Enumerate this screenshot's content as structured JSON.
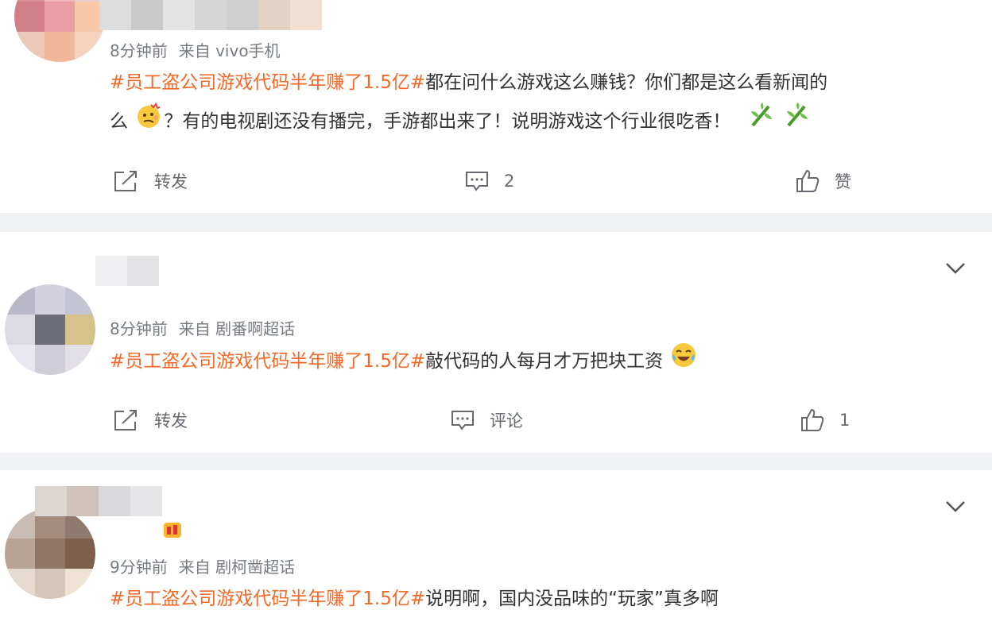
{
  "comments": [
    {
      "time": "8分钟前",
      "source": "来自 vivo手机",
      "topic": "#员工盗公司游戏代码半年赚了1.5亿#",
      "text_part1": "都在问什么游戏这么赚钱？你们都是这么看新闻的",
      "text_part2_prefix": "么",
      "text_part2": "？有的电视剧还没有播完，手游都出来了！说明游戏这个行业很吃香！",
      "repost_label": "转发",
      "comment_count": "2",
      "like_label": "赞",
      "emoji_1": "confused-face-emoji",
      "emoji_2": "bamboo-emoji"
    },
    {
      "time": "8分钟前",
      "source": "来自 剧番啊超话",
      "topic": "#员工盗公司游戏代码半年赚了1.5亿#",
      "text": "敲代码的人每月才万把块工资",
      "repost_label": "转发",
      "comment_label": "评论",
      "like_count": "1",
      "emoji": "laugh-cry-emoji"
    },
    {
      "time": "9分钟前",
      "source": "来自 剧柯凿超话",
      "topic": "#员工盗公司游戏代码半年赚了1.5亿#",
      "text": "说明啊，国内没品味的“玩家”真多啊",
      "badge": "fan-badge-icon"
    }
  ],
  "colors": {
    "topic": "#f26a2a",
    "text": "#333333",
    "meta": "#777b82",
    "icon": "#666a70"
  }
}
